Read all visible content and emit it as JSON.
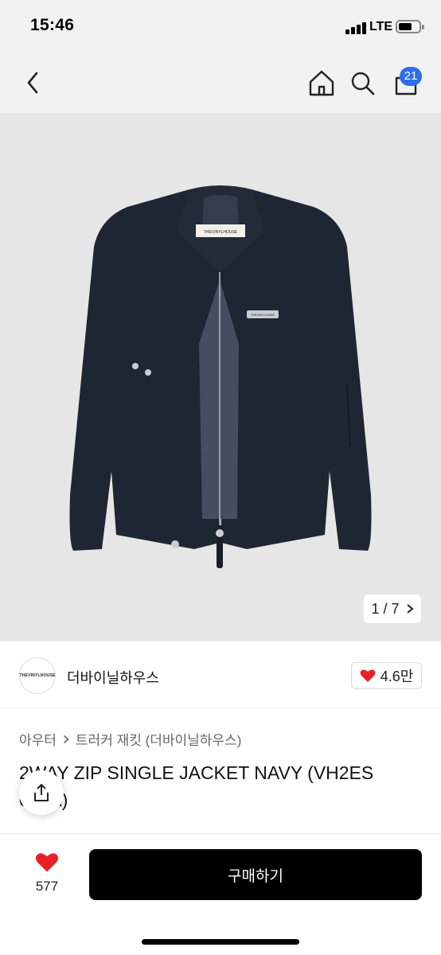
{
  "status_bar": {
    "time": "15:46",
    "network": "LTE"
  },
  "nav": {
    "icons": [
      "back-arrow-icon",
      "home-icon",
      "search-icon",
      "shopping-bag-icon"
    ],
    "cart_badge": "21"
  },
  "gallery": {
    "counter": "1 / 7"
  },
  "seller": {
    "avatar_text": "THEVINYLHOUSE",
    "name": "더바이닐하우스",
    "likes": "4.6만"
  },
  "breadcrumb": {
    "category": "아우터",
    "subcategory": "트러커 재킷 (더바이닐하우스)"
  },
  "product": {
    "title": "2WAY ZIP SINGLE JACKET NAVY (VH2ES 042A)",
    "garment_label": "THEVINYLHOUSE",
    "chest_label": "THEVINYLHOUSE"
  },
  "bottom_bar": {
    "wish_count": "577",
    "buy_label": "구매하기"
  },
  "colors": {
    "badge": "#2f6fe6",
    "heart": "#e8202a",
    "jacket": "#1f2633",
    "image_bg": "#e6e6e6",
    "buy_button": "#000000"
  }
}
